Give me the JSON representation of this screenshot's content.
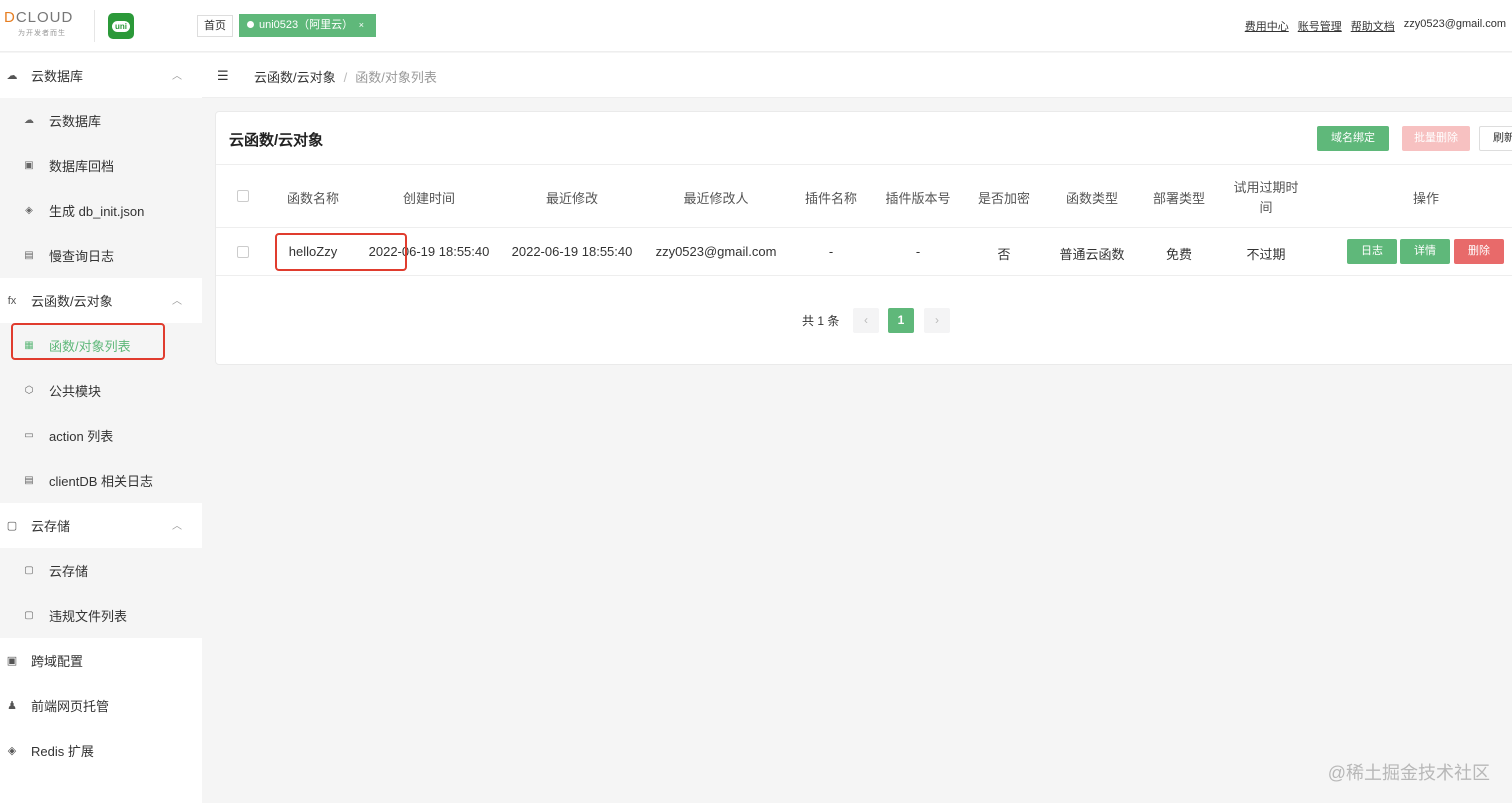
{
  "brand": {
    "logo_text": "DCLOUD",
    "logo_sub": "为开发者而生",
    "uni_icon_label": "uni"
  },
  "tabs": {
    "home": "首页",
    "active": "uni0523（阿里云）",
    "close": "×"
  },
  "top_links": {
    "billing": "费用中心",
    "account": "账号管理",
    "help": "帮助文档",
    "email": "zzy0523@gmail.com"
  },
  "sidebar": {
    "groups": [
      {
        "label": "云数据库",
        "icon": "database-icon",
        "items": [
          {
            "label": "云数据库",
            "icon": "database-icon"
          },
          {
            "label": "数据库回档",
            "icon": "rollback-icon"
          },
          {
            "label": "生成 db_init.json",
            "icon": "generate-icon"
          },
          {
            "label": "慢查询日志",
            "icon": "log-icon"
          }
        ]
      },
      {
        "label": "云函数/云对象",
        "icon": "fx-icon",
        "items": [
          {
            "label": "函数/对象列表",
            "icon": "list-icon",
            "active": true
          },
          {
            "label": "公共模块",
            "icon": "module-icon"
          },
          {
            "label": "action 列表",
            "icon": "action-icon"
          },
          {
            "label": "clientDB 相关日志",
            "icon": "log-icon"
          }
        ]
      },
      {
        "label": "云存储",
        "icon": "storage-icon",
        "items": [
          {
            "label": "云存储",
            "icon": "storage-icon"
          },
          {
            "label": "违规文件列表",
            "icon": "file-icon"
          }
        ]
      }
    ],
    "singles": [
      {
        "label": "跨域配置",
        "icon": "cors-icon"
      },
      {
        "label": "前端网页托管",
        "icon": "hosting-icon"
      },
      {
        "label": "Redis 扩展",
        "icon": "redis-icon"
      }
    ]
  },
  "breadcrumb": {
    "parent": "云函数/云对象",
    "sep": "/",
    "current": "函数/对象列表"
  },
  "card": {
    "title": "云函数/云对象",
    "buttons": {
      "bind": "域名绑定",
      "batch_delete": "批量删除",
      "refresh": "刷新"
    }
  },
  "table": {
    "headers": [
      "函数名称",
      "创建时间",
      "最近修改",
      "最近修改人",
      "插件名称",
      "插件版本号",
      "是否加密",
      "函数类型",
      "部署类型",
      "试用过期时间",
      "操作"
    ],
    "header_expire_line1": "试用过期时",
    "header_expire_line2": "间",
    "rows": [
      {
        "name": "helloZzy",
        "created": "2022-06-19 18:55:40",
        "modified": "2022-06-19 18:55:40",
        "modifier": "zzy0523@gmail.com",
        "plugin": "-",
        "plugin_version": "-",
        "encrypted": "否",
        "type": "普通云函数",
        "deploy": "免费",
        "expire": "不过期"
      }
    ],
    "actions": {
      "log": "日志",
      "detail": "详情",
      "delete": "删除"
    }
  },
  "pager": {
    "total": "共 1 条",
    "prev": "‹",
    "current": "1",
    "next": "›"
  },
  "watermark": "@稀土掘金技术社区",
  "colors": {
    "accent": "#5fb87a",
    "danger": "#e86a6a",
    "danger_disabled": "#f7c1c1",
    "highlight": "#e03c2e"
  }
}
